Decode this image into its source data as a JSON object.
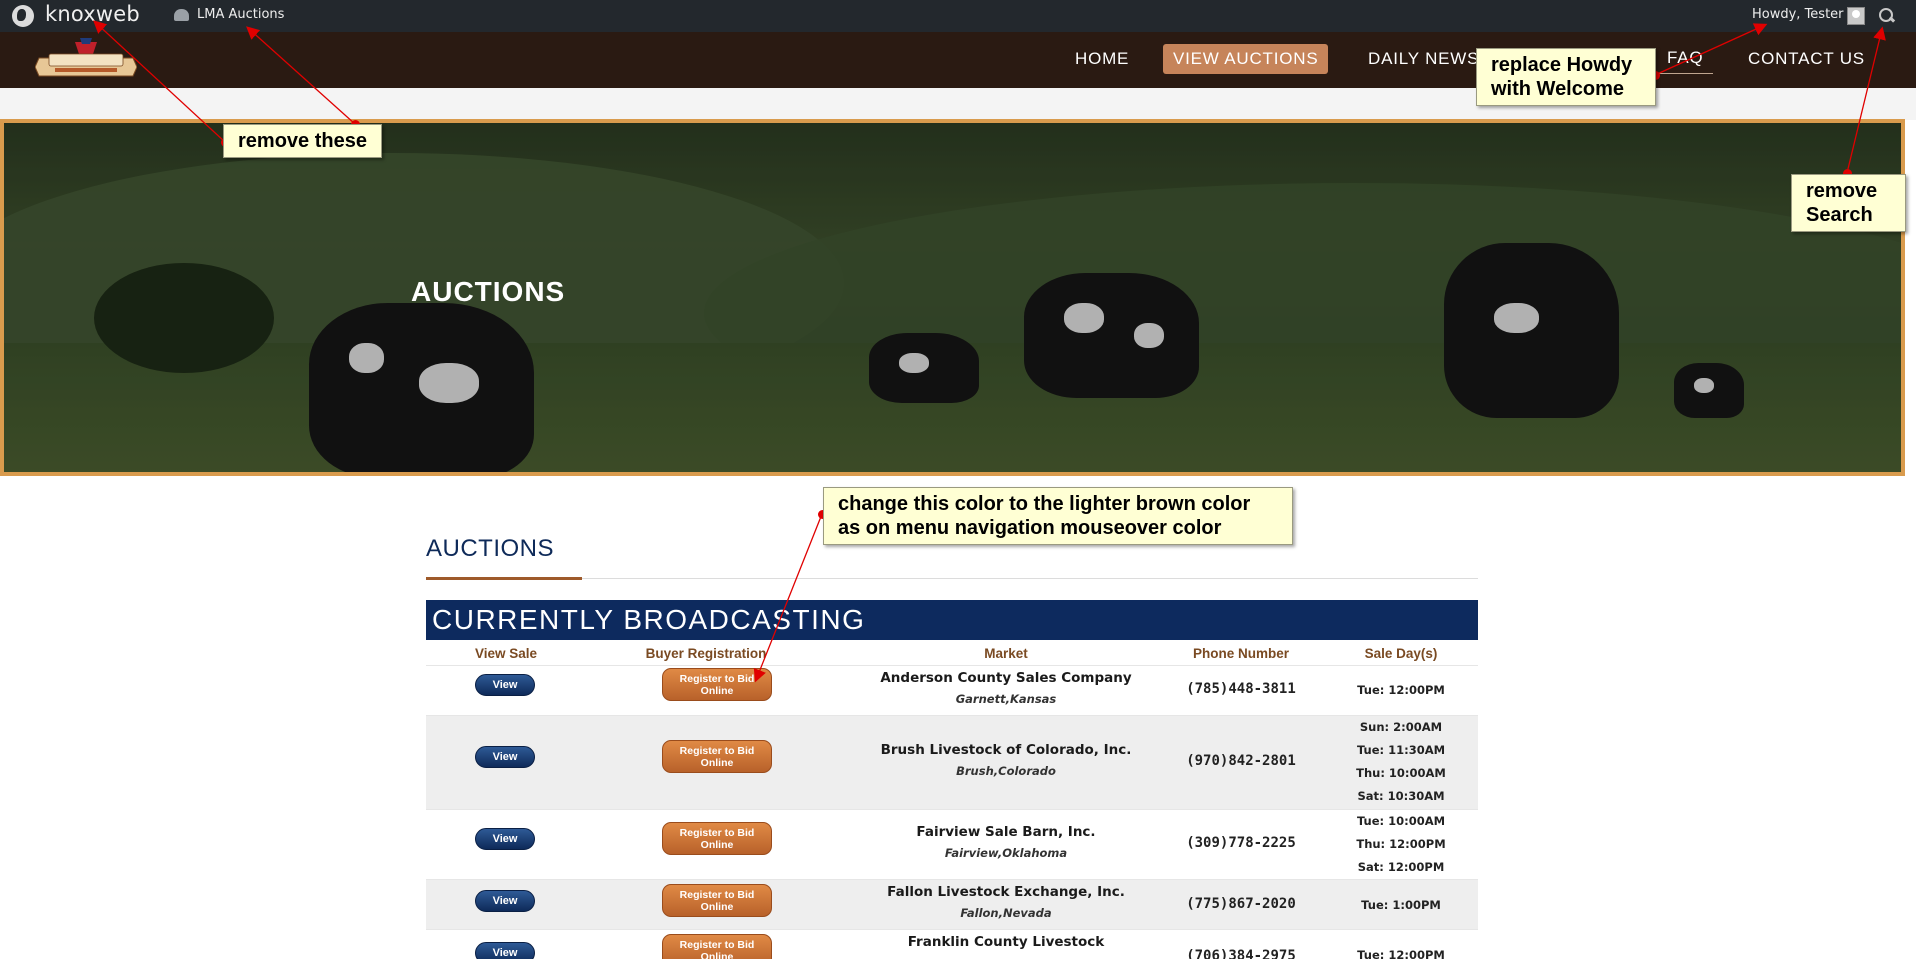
{
  "adminbar": {
    "brand": "knoxweb",
    "site_name": "LMA Auctions",
    "howdy": "Howdy, Tester"
  },
  "nav": {
    "items": [
      "HOME",
      "VIEW AUCTIONS",
      "DAILY NEWS",
      "FAQ",
      "CONTACT US"
    ]
  },
  "hero": {
    "title": "AUCTIONS"
  },
  "section": {
    "title": "AUCTIONS",
    "broadcast_label": "CURRENTLY BROADCASTING"
  },
  "table": {
    "headers": [
      "View Sale",
      "Buyer Registration",
      "Market",
      "Phone Number",
      "Sale Day(s)"
    ],
    "rows": [
      {
        "view_label": "View",
        "register_label": "Register to Bid Online",
        "market": "Anderson County Sales Company",
        "location": "Garnett,Kansas",
        "phone": "(785)448-3811",
        "days": [
          "Tue: 12:00PM"
        ]
      },
      {
        "view_label": "View",
        "register_label": "Register to Bid Online",
        "market": "Brush Livestock of Colorado, Inc.",
        "location": "Brush,Colorado",
        "phone": "(970)842-2801",
        "days": [
          "Sun: 2:00AM",
          "Tue: 11:30AM",
          "Thu: 10:00AM",
          "Sat: 10:30AM"
        ]
      },
      {
        "view_label": "View",
        "register_label": "Register to Bid Online",
        "market": "Fairview Sale Barn, Inc.",
        "location": "Fairview,Oklahoma",
        "phone": "(309)778-2225",
        "days": [
          "Tue: 10:00AM",
          "Thu: 12:00PM",
          "Sat: 12:00PM"
        ]
      },
      {
        "view_label": "View",
        "register_label": "Register to Bid Online",
        "market": "Fallon Livestock Exchange, Inc.",
        "location": "Fallon,Nevada",
        "phone": "(775)867-2020",
        "days": [
          "Tue: 1:00PM"
        ]
      },
      {
        "view_label": "View",
        "register_label": "Register to Bid Online",
        "market": "Franklin County Livestock",
        "location": "",
        "phone": "(706)384-2975",
        "days": [
          "Tue: 12:00PM"
        ]
      }
    ]
  },
  "annotations": {
    "remove_these": "remove these",
    "replace_howdy": "replace Howdy with Welcome",
    "remove_search": "remove Search",
    "change_color": "change this color to the lighter brown color as on menu navigation mouseover color"
  },
  "colors": {
    "adminbar_bg": "#23282d",
    "nav_bg": "#2a1a12",
    "nav_hover": "#c6845a",
    "navy": "#0d2a5e",
    "register_orange": "#c66f33",
    "hero_border": "#d99b4d",
    "note_bg": "#ffffd4",
    "arrow_red": "#e00000"
  }
}
